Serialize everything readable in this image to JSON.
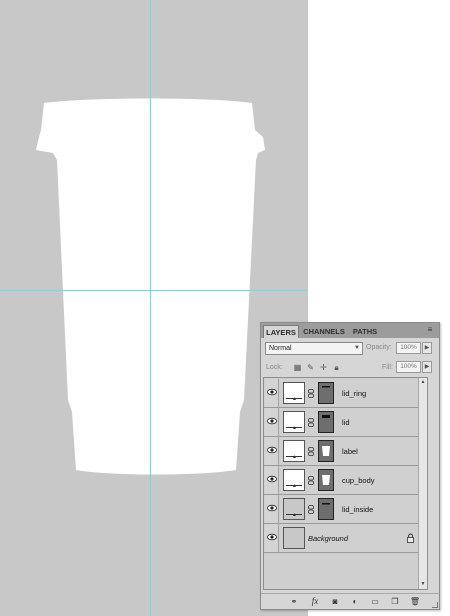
{
  "panel": {
    "tabs": [
      {
        "label": "LAYERS",
        "active": true
      },
      {
        "label": "CHANNELS",
        "active": false
      },
      {
        "label": "PATHS",
        "active": false
      }
    ],
    "blend_mode": "Normal",
    "opacity_label": "Opacity:",
    "opacity_value": "100%",
    "lock_label": "Lock:",
    "fill_label": "Fill:",
    "fill_value": "100%",
    "layers": [
      {
        "name": "lid_ring",
        "visible": true,
        "thumb": "white",
        "mask": "lid-ring-shape"
      },
      {
        "name": "lid",
        "visible": true,
        "thumb": "white",
        "mask": "lid-shape"
      },
      {
        "name": "label",
        "visible": true,
        "thumb": "white",
        "mask": "cup-shape"
      },
      {
        "name": "cup_body",
        "visible": true,
        "thumb": "white",
        "mask": "cup-shape"
      },
      {
        "name": "lid_inside",
        "visible": true,
        "thumb": "gray",
        "mask": "lid-inside-shape"
      },
      {
        "name": "Background",
        "visible": true,
        "thumb": "gray",
        "mask": null,
        "locked": true
      }
    ],
    "bottom_icons": [
      "link-icon",
      "fx-icon",
      "add-mask-icon",
      "adjustment-icon",
      "group-folder-icon",
      "new-layer-icon",
      "trash-icon"
    ]
  },
  "colors": {
    "canvas_bg": "#c8c8c8",
    "cup": "#ffffff",
    "guide": "#5fe3e3",
    "panel_bg": "#d6d6d6"
  }
}
